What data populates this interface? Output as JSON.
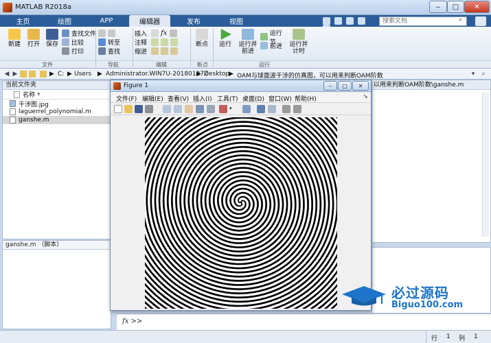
{
  "window": {
    "title": "MATLAB R2018a",
    "minimize": "‒",
    "maximize": "□",
    "close": "✕"
  },
  "tabs": [
    "主页",
    "绘图",
    "APP",
    "编辑器",
    "发布",
    "视图"
  ],
  "active_tab": "编辑器",
  "search": {
    "placeholder": "搜索文档"
  },
  "toolstrip": {
    "new_label": "新建",
    "open_label": "打开",
    "save_label": "保存",
    "find_files_label": "查找文件",
    "compare_label": "比较",
    "print_label": "打印",
    "goto_label": "转至",
    "find_label": "查找",
    "insert_label": "插入",
    "comment_label": "注释",
    "indent_label": "缩进",
    "fx_label": "fx",
    "breakpoint_label": "断点",
    "run_label": "运行",
    "run_advance_label": "运行并\n前进",
    "run_section_label": "运行节",
    "advance_label": "前进",
    "run_time_label": "运行并\n计时",
    "groups": [
      "文件",
      "导航",
      "编辑",
      "断点",
      "运行"
    ]
  },
  "address": {
    "segments": [
      "C:",
      "Users",
      "Administrator.WIN7U-20180127Z",
      "Desktop",
      "OAM与球面波干涉的仿真图，可以用来判断OAM阶数"
    ],
    "right_crumb": "以用来判断OAM阶数\\ganshe.m"
  },
  "file_browser": {
    "title": "当前文件夹",
    "column": "名称",
    "files": [
      {
        "name": "干涉图.jpg",
        "selected": false
      },
      {
        "name": "laguerrel_polynomial.m",
        "selected": false
      },
      {
        "name": "ganshe.m",
        "selected": true
      }
    ],
    "details": "ganshe.m （脚本）"
  },
  "figure": {
    "title": "Figure 1",
    "menu": [
      "文件(F)",
      "编辑(E)",
      "查看(V)",
      "插入(I)",
      "工具(T)",
      "桌面(D)",
      "窗口(W)",
      "帮助(H)"
    ]
  },
  "command": {
    "prompt": "fx >>"
  },
  "status": {
    "row_label": "行",
    "row": "1",
    "col_label": "列",
    "col": "1"
  },
  "watermark": {
    "cn": "必过源码",
    "url": "Biguo100.com"
  },
  "colors": {
    "tab_bar": "#2b5d9a",
    "accent": "#1f6fc4",
    "watermark": "#1d74c9"
  }
}
